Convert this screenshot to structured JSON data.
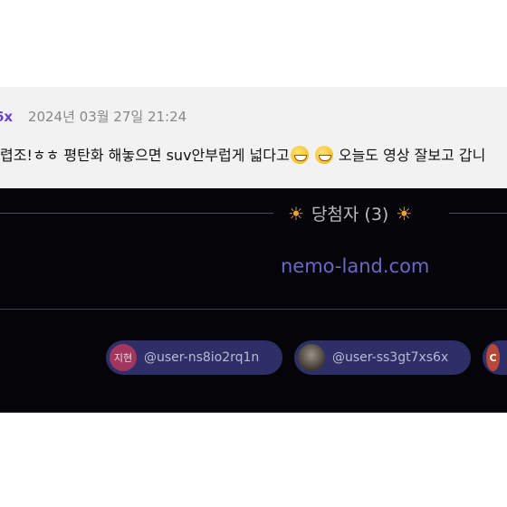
{
  "comment": {
    "author": "6x",
    "timestamp": "2024년 03월 27일 21:24",
    "text_part1": "렵조!ㅎㅎ 평탄화 해놓으면 suv안부럽게 넓다고",
    "text_part2": "오늘도 영상 잘보고 갑니"
  },
  "winners": {
    "sun_glyph": "☀",
    "header": "당첨자 (3)",
    "site": "nemo-land.com",
    "chips": [
      {
        "avatar_text": "지현",
        "handle": "@user-ns8io2rq1n"
      },
      {
        "avatar_text": "",
        "handle": "@user-ss3gt7xs6x"
      },
      {
        "avatar_text": "C",
        "handle": ""
      }
    ]
  },
  "colors": {
    "accent": "#6a3fd6",
    "panel_bg": "#050509",
    "chip_bg": "#2e2f66",
    "site_text": "#6b67c9",
    "sun": "#f0a23a"
  }
}
